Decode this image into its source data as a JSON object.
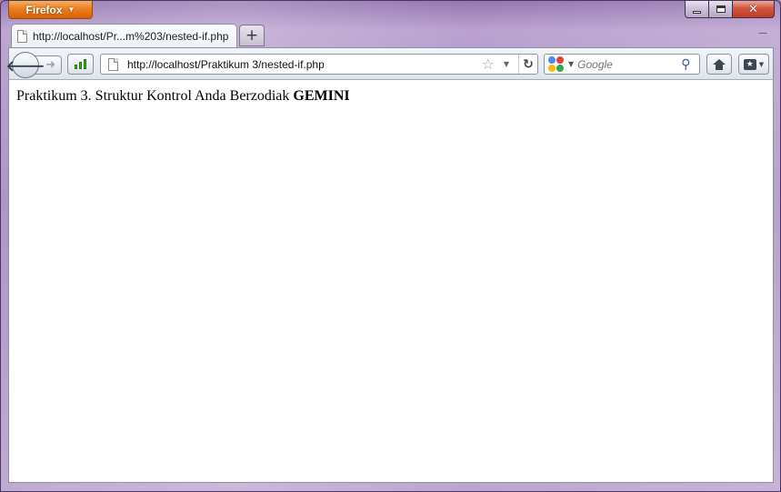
{
  "browser": {
    "menu_button_label": "Firefox",
    "tab_title": "http://localhost/Pr...m%203/nested-if.php",
    "new_tab_symbol": "+",
    "url": "http://localhost/Praktikum 3/nested-if.php",
    "search_placeholder": "Google",
    "icons": {
      "back": "back-arrow-icon",
      "forward": "forward-arrow-icon",
      "signal": "connection-signal-icon",
      "page": "page-icon",
      "star": "bookmark-star-icon",
      "reload": "reload-icon",
      "search_engine": "google-icon",
      "search_go": "magnifier-icon",
      "home": "home-icon",
      "bookmarks": "bookmarks-icon"
    },
    "colors": {
      "firefox_button": "#e97b1d",
      "close_button": "#c33b22",
      "window_frame": "#a58ac0"
    }
  },
  "page": {
    "text": "Praktikum 3. Struktur Kontrol Anda Berzodiak",
    "zodiac": "GEMINI"
  }
}
